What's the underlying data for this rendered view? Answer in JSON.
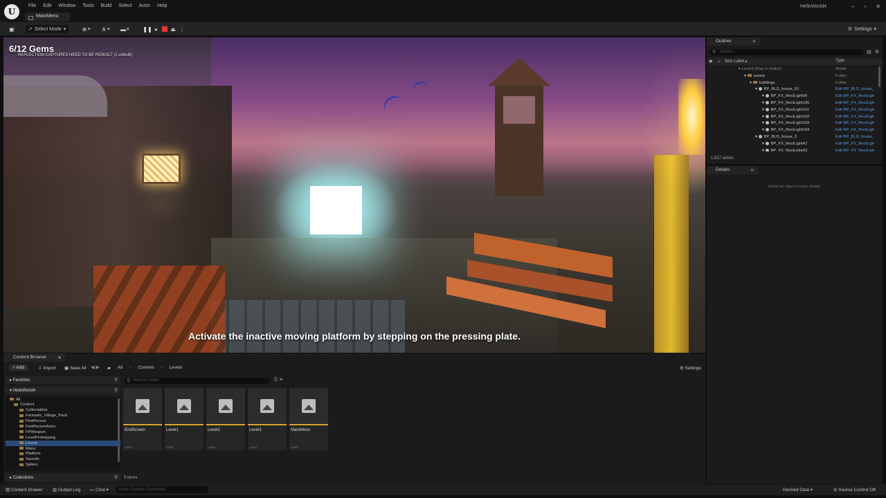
{
  "titlebar": {
    "logo_letter": "U",
    "menu": [
      "File",
      "Edit",
      "Window",
      "Tools",
      "Build",
      "Select",
      "Actor",
      "Help"
    ],
    "project_tab": "MainMenu",
    "project_name": "HelloWorld4",
    "window_buttons": [
      "–",
      "▫",
      "✕"
    ]
  },
  "toolbar": {
    "save_icon": "▣",
    "select_mode": "Select Mode",
    "settings_label": "Settings"
  },
  "viewport": {
    "gems": "6/12 Gems",
    "warning": "REFLECTION CAPTURES NEED TO BE REBUILT (1 unbuilt)",
    "subtitle": "Activate the inactive moving platform by stepping on the pressing plate."
  },
  "outliner": {
    "tab": "Outliner",
    "search_placeholder": "Search...",
    "col_label": "Item Label ▴",
    "col_type": "Type",
    "rows": [
      {
        "name": "Level3 (Play In Editor)",
        "type": "World",
        "indent": 46,
        "icon": "none",
        "muted": true,
        "link": false
      },
      {
        "name": "assets",
        "type": "Folder",
        "indent": 54,
        "icon": "folder",
        "muted": false,
        "link": false
      },
      {
        "name": "buildings",
        "type": "Folder",
        "indent": 62,
        "icon": "folder",
        "muted": false,
        "link": false
      },
      {
        "name": "BP_BLD_house_01",
        "type": "Edit BP_BLD_house_",
        "indent": 70,
        "icon": "bp",
        "muted": false,
        "link": true
      },
      {
        "name": "BP_FX_RectLight99",
        "type": "Edit BP_FX_RectLigh",
        "indent": 80,
        "icon": "bp",
        "muted": false,
        "link": true
      },
      {
        "name": "BP_FX_RectLight100",
        "type": "Edit BP_FX_RectLigh",
        "indent": 80,
        "icon": "bp",
        "muted": false,
        "link": true
      },
      {
        "name": "BP_FX_RectLight101",
        "type": "Edit BP_FX_RectLigh",
        "indent": 80,
        "icon": "bp",
        "muted": false,
        "link": true
      },
      {
        "name": "BP_FX_RectLight102",
        "type": "Edit BP_FX_RectLigh",
        "indent": 80,
        "icon": "bp",
        "muted": false,
        "link": true
      },
      {
        "name": "BP_FX_RectLight103",
        "type": "Edit BP_FX_RectLigh",
        "indent": 80,
        "icon": "bp",
        "muted": false,
        "link": true
      },
      {
        "name": "BP_FX_RectLight104",
        "type": "Edit BP_FX_RectLigh",
        "indent": 80,
        "icon": "bp",
        "muted": false,
        "link": true
      },
      {
        "name": "BP_BLD_house_3",
        "type": "Edit BP_BLD_house_",
        "indent": 70,
        "icon": "bp",
        "muted": false,
        "link": true
      },
      {
        "name": "BP_FX_RectLight42",
        "type": "Edit BP_FX_RectLigh",
        "indent": 80,
        "icon": "bp",
        "muted": false,
        "link": true
      },
      {
        "name": "BP_FX_RectLight43",
        "type": "Edit BP_FX_RectLigh",
        "indent": 80,
        "icon": "bp",
        "muted": false,
        "link": true
      }
    ],
    "footer": "1,917 actors"
  },
  "details": {
    "tab": "Details",
    "empty_text": "Select an object to view details."
  },
  "content_browser": {
    "tab": "Content Browser",
    "add_label": "Add",
    "import_label": "Import",
    "save_all_label": "Save All",
    "breadcrumbs": [
      "All",
      "Content",
      "Levels"
    ],
    "settings_label": "Settings",
    "favorites_label": "Favorites",
    "project_label": "HelloWorld4",
    "collections_label": "Collections",
    "search_placeholder": "Search Levels",
    "tree": [
      {
        "name": "All",
        "indent": 6,
        "selected": false
      },
      {
        "name": "Content",
        "indent": 12,
        "selected": false
      },
      {
        "name": "Collectables",
        "indent": 20,
        "selected": false
      },
      {
        "name": "Fantastic_Village_Pack",
        "indent": 20,
        "selected": false
      },
      {
        "name": "FirstPerson",
        "indent": 20,
        "selected": false
      },
      {
        "name": "FirstPersonArms",
        "indent": 20,
        "selected": false
      },
      {
        "name": "FPWeapon",
        "indent": 20,
        "selected": false
      },
      {
        "name": "LevelPrototyping",
        "indent": 20,
        "selected": false
      },
      {
        "name": "Levels",
        "indent": 20,
        "selected": true
      },
      {
        "name": "Menu",
        "indent": 20,
        "selected": false
      },
      {
        "name": "Platform",
        "indent": 20,
        "selected": false
      },
      {
        "name": "Sounds",
        "indent": 20,
        "selected": false
      },
      {
        "name": "Spikes",
        "indent": 20,
        "selected": false
      }
    ],
    "assets": [
      {
        "name": "EndScreen",
        "type": "Level"
      },
      {
        "name": "Level1",
        "type": "Level"
      },
      {
        "name": "Level2",
        "type": "Level"
      },
      {
        "name": "Level3",
        "type": "Level"
      },
      {
        "name": "MainMenu",
        "type": "Level"
      }
    ],
    "item_count": "5 items"
  },
  "statusbar": {
    "content_drawer": "Content Drawer",
    "output_log": "Output Log",
    "cmd": "Cmd",
    "console_placeholder": "Enter Console Command",
    "derived_data": "Derived Data",
    "source_control": "Source Control Off"
  }
}
